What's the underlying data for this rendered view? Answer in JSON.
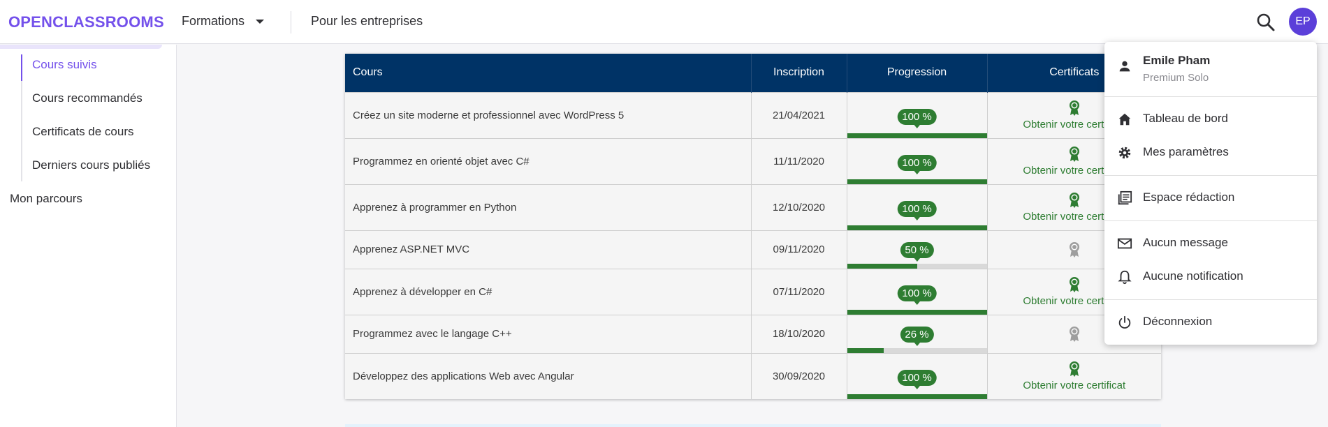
{
  "header": {
    "logo": "OPENCLASSROOMS",
    "nav_formations": "Formations",
    "nav_entreprises": "Pour les entreprises",
    "avatar_initials": "EP"
  },
  "sidebar": {
    "items": [
      {
        "label": "Cours suivis",
        "active": true
      },
      {
        "label": "Cours recommandés"
      },
      {
        "label": "Certificats de cours"
      },
      {
        "label": "Derniers cours publiés"
      }
    ],
    "root_item": "Mon parcours"
  },
  "table": {
    "headers": {
      "cours": "Cours",
      "inscription": "Inscription",
      "progression": "Progression",
      "certificats": "Certificats"
    },
    "rows": [
      {
        "cours": "Créez un site moderne et professionnel avec WordPress 5",
        "inscription": "21/04/2021",
        "progress": 100,
        "progress_label": "100 %",
        "cert_link": "Obtenir votre certificat"
      },
      {
        "cours": "Programmez en orienté objet avec C#",
        "inscription": "11/11/2020",
        "progress": 100,
        "progress_label": "100 %",
        "cert_link": "Obtenir votre certificat"
      },
      {
        "cours": "Apprenez à programmer en Python",
        "inscription": "12/10/2020",
        "progress": 100,
        "progress_label": "100 %",
        "cert_link": "Obtenir votre certificat"
      },
      {
        "cours": "Apprenez ASP.NET MVC",
        "inscription": "09/11/2020",
        "progress": 50,
        "progress_label": "50 %",
        "cert_link": ""
      },
      {
        "cours": "Apprenez à développer en C#",
        "inscription": "07/11/2020",
        "progress": 100,
        "progress_label": "100 %",
        "cert_link": "Obtenir votre certificat"
      },
      {
        "cours": "Programmez avec le langage C++",
        "inscription": "18/10/2020",
        "progress": 26,
        "progress_label": "26 %",
        "cert_link": ""
      },
      {
        "cours": "Développez des applications Web avec Angular",
        "inscription": "30/09/2020",
        "progress": 100,
        "progress_label": "100 %",
        "cert_link": "Obtenir votre certificat"
      }
    ]
  },
  "menu": {
    "user_name": "Emile Pham",
    "user_plan": "Premium Solo",
    "items": [
      {
        "label": "Tableau de bord",
        "icon": "home-icon"
      },
      {
        "label": "Mes paramètres",
        "icon": "gear-icon"
      },
      {
        "label": "Espace rédaction",
        "icon": "library-books-icon"
      },
      {
        "label": "Aucun message",
        "icon": "mail-icon"
      },
      {
        "label": "Aucune notification",
        "icon": "bell-icon"
      },
      {
        "label": "Déconnexion",
        "icon": "power-icon"
      }
    ]
  },
  "colors": {
    "brand": "#7451eb",
    "table_header": "#003366",
    "success": "#2e7d32",
    "avatar": "#5b3fd9"
  }
}
